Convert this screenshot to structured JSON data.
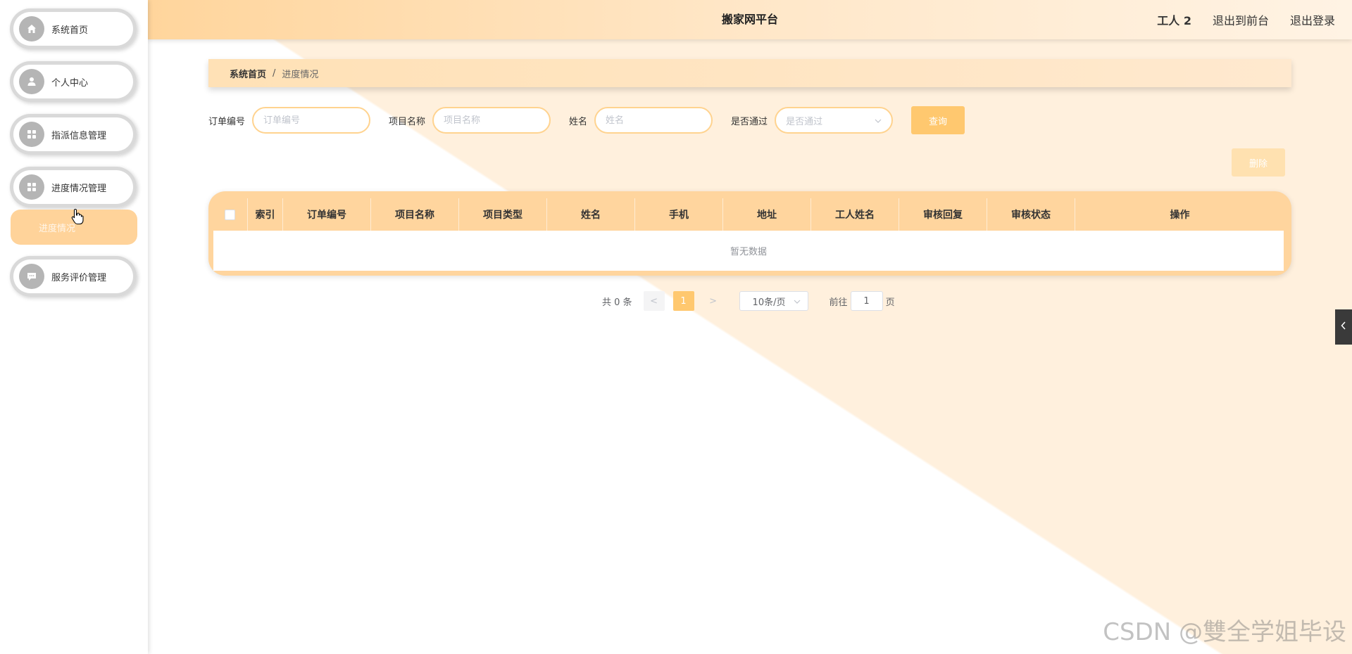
{
  "header": {
    "title": "搬家网平台",
    "user": "工人 2",
    "back_to_front": "退出到前台",
    "logout": "退出登录"
  },
  "sidebar": {
    "items": [
      {
        "label": "系统首页",
        "icon": "home-icon"
      },
      {
        "label": "个人中心",
        "icon": "user-icon"
      },
      {
        "label": "指派信息管理",
        "icon": "grid-icon"
      },
      {
        "label": "进度情况管理",
        "icon": "grid-icon"
      },
      {
        "label": "服务评价管理",
        "icon": "chat-icon"
      }
    ],
    "submenu_label": "进度情况"
  },
  "breadcrumb": {
    "home": "系统首页",
    "separator": "/",
    "current": "进度情况"
  },
  "search": {
    "order_no_label": "订单编号",
    "order_no_placeholder": "订单编号",
    "project_name_label": "项目名称",
    "project_name_placeholder": "项目名称",
    "name_label": "姓名",
    "name_placeholder": "姓名",
    "approved_label": "是否通过",
    "approved_placeholder": "是否通过",
    "query_button": "查询"
  },
  "actions": {
    "delete_button": "删除"
  },
  "table": {
    "columns": [
      "索引",
      "订单编号",
      "项目名称",
      "项目类型",
      "姓名",
      "手机",
      "地址",
      "工人姓名",
      "审核回复",
      "审核状态",
      "操作"
    ],
    "empty_text": "暂无数据"
  },
  "pagination": {
    "total": "共 0 条",
    "prev": "<",
    "current_page": "1",
    "next": ">",
    "page_size": "10条/页",
    "goto_label": "前往",
    "goto_value": "1",
    "page_suffix": "页"
  },
  "watermark": "CSDN @雙全学姐毕设",
  "colors": {
    "accent": "#ffc86f",
    "header_start": "#ffd59c",
    "table_header": "#ffd59e"
  }
}
